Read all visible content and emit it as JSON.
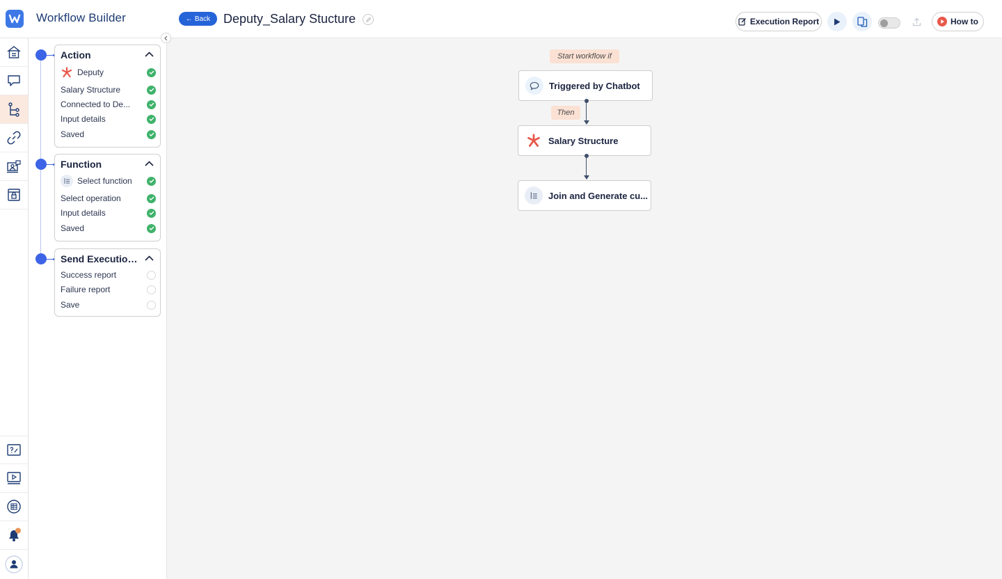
{
  "header": {
    "app_title": "Workflow Builder",
    "back_label": "Back",
    "workflow_name": "Deputy_Salary Stucture",
    "execution_report_label": "Execution Report",
    "how_to_label": "How to",
    "toggle_on": false
  },
  "nav": {
    "top_items": [
      "home-icon",
      "chat-icon",
      "workflow-icon",
      "link-icon",
      "agent-icon",
      "store-icon"
    ],
    "bottom_items": [
      "help-icon",
      "video-icon",
      "docs-icon",
      "bell-icon",
      "user-icon"
    ],
    "active": "workflow-icon"
  },
  "steps": [
    {
      "title": "Action",
      "header_item": {
        "label": "Deputy",
        "icon": "deputy-icon",
        "done": true
      },
      "items": [
        {
          "label": "Salary Structure",
          "done": true
        },
        {
          "label": "Connected to  De...",
          "done": true
        },
        {
          "label": "Input details",
          "done": true
        },
        {
          "label": "Saved",
          "done": true
        }
      ]
    },
    {
      "title": "Function",
      "header_item": {
        "label": "Select function",
        "icon": "function-icon",
        "done": true
      },
      "items": [
        {
          "label": "Select operation",
          "done": true
        },
        {
          "label": "Input details",
          "done": true
        },
        {
          "label": "Saved",
          "done": true
        }
      ]
    },
    {
      "title": "Send Execution R...",
      "items": [
        {
          "label": "Success report",
          "done": false
        },
        {
          "label": "Failure report",
          "done": false
        },
        {
          "label": "Save",
          "done": false
        }
      ]
    }
  ],
  "canvas": {
    "start_tag": "Start workflow if",
    "then_tag": "Then",
    "nodes": [
      {
        "label": "Triggered by Chatbot",
        "icon": "chat-bubble-icon"
      },
      {
        "label": "Salary Structure",
        "icon": "deputy-icon"
      },
      {
        "label": "Join and Generate cu...",
        "icon": "function-icon"
      }
    ]
  },
  "colors": {
    "accent": "#2563d8",
    "step_dot": "#3d64e6",
    "check": "#3fb26b",
    "tag_bg": "#fbe1d3",
    "active_nav": "#fbe9df",
    "deputy": "#e8584a",
    "notification": "#e9955a"
  }
}
